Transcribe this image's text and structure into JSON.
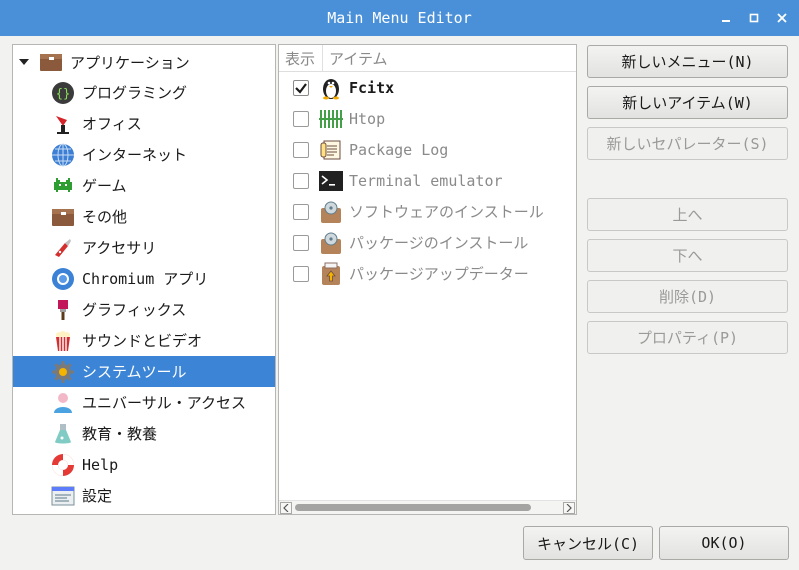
{
  "window": {
    "title": "Main Menu Editor",
    "controls": {
      "minimize": "minimize-icon",
      "maximize": "maximize-icon",
      "close": "close-icon"
    }
  },
  "tree": {
    "root": {
      "label": "アプリケーション",
      "icon": "folder-icon"
    },
    "items": [
      {
        "label": "プログラミング",
        "icon": "programming-icon"
      },
      {
        "label": "オフィス",
        "icon": "office-icon"
      },
      {
        "label": "インターネット",
        "icon": "globe-icon"
      },
      {
        "label": "ゲーム",
        "icon": "game-invader-icon"
      },
      {
        "label": "その他",
        "icon": "folder-icon"
      },
      {
        "label": "アクセサリ",
        "icon": "knife-icon"
      },
      {
        "label": "Chromium アプリ",
        "icon": "chromium-icon"
      },
      {
        "label": "グラフィックス",
        "icon": "paint-brush-icon"
      },
      {
        "label": "サウンドとビデオ",
        "icon": "popcorn-icon"
      },
      {
        "label": "システムツール",
        "icon": "gear-icon",
        "selected": true
      },
      {
        "label": "ユニバーサル・アクセス",
        "icon": "accessibility-person-icon"
      },
      {
        "label": "教育・教養",
        "icon": "flask-icon"
      },
      {
        "label": "Help",
        "icon": "lifebuoy-icon"
      },
      {
        "label": "設定",
        "icon": "settings-panel-icon"
      }
    ]
  },
  "items_list": {
    "header": {
      "show": "表示",
      "item": "アイテム"
    },
    "rows": [
      {
        "label": "Fcitx",
        "checked": true,
        "icon": "penguin-icon"
      },
      {
        "label": "Htop",
        "checked": false,
        "icon": "htop-bars-icon"
      },
      {
        "label": "Package Log",
        "checked": false,
        "icon": "log-document-icon"
      },
      {
        "label": "Terminal emulator",
        "checked": false,
        "icon": "terminal-icon"
      },
      {
        "label": "ソフトウェアのインストール",
        "checked": false,
        "icon": "package-install-icon"
      },
      {
        "label": "パッケージのインストール",
        "checked": false,
        "icon": "package-install-icon"
      },
      {
        "label": "パッケージアップデーター",
        "checked": false,
        "icon": "package-update-icon"
      }
    ]
  },
  "buttons": {
    "new_menu": "新しいメニュー(N)",
    "new_item": "新しいアイテム(W)",
    "new_separator": "新しいセパレーター(S)",
    "move_up": "上へ",
    "move_down": "下へ",
    "delete": "削除(D)",
    "properties": "プロパティ(P)",
    "cancel": "キャンセル(C)",
    "ok": "OK(O)"
  },
  "colors": {
    "titlebar": "#4a90d9",
    "selection": "#3b84d6"
  }
}
